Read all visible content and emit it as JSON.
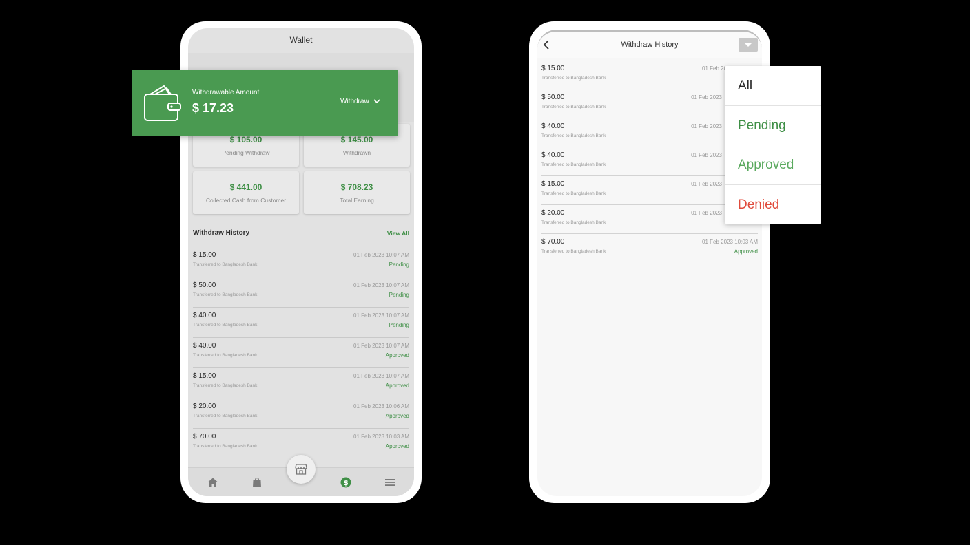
{
  "colors": {
    "brand_green": "#4a9a51",
    "text_green": "#3f8f46",
    "approved_green": "#5aa95e",
    "denied_red": "#e04b3c"
  },
  "wallet": {
    "title": "Wallet",
    "withdrawable_label": "Withdrawable Amount",
    "withdrawable_amount": "$ 17.23",
    "withdraw_button": "Withdraw",
    "stats": [
      {
        "value": "$ 105.00",
        "label": "Pending Withdraw"
      },
      {
        "value": "$ 145.00",
        "label": "Withdrawn"
      },
      {
        "value": "$ 441.00",
        "label": "Collected Cash from Customer"
      },
      {
        "value": "$ 708.23",
        "label": "Total Earning"
      }
    ],
    "history_title": "Withdraw History",
    "view_all": "View All",
    "history": [
      {
        "amount": "$ 15.00",
        "desc": "Transferred to Bangladesh Bank",
        "date": "01 Feb 2023  10:07 AM",
        "status": "Pending"
      },
      {
        "amount": "$ 50.00",
        "desc": "Transferred to Bangladesh Bank",
        "date": "01 Feb 2023  10:07 AM",
        "status": "Pending"
      },
      {
        "amount": "$ 40.00",
        "desc": "Transferred to Bangladesh Bank",
        "date": "01 Feb 2023  10:07 AM",
        "status": "Pending"
      },
      {
        "amount": "$ 40.00",
        "desc": "Transferred to Bangladesh Bank",
        "date": "01 Feb 2023  10:07 AM",
        "status": "Approved"
      },
      {
        "amount": "$ 15.00",
        "desc": "Transferred to Bangladesh Bank",
        "date": "01 Feb 2023  10:07 AM",
        "status": "Approved"
      },
      {
        "amount": "$ 20.00",
        "desc": "Transferred to Bangladesh Bank",
        "date": "01 Feb 2023  10:06 AM",
        "status": "Approved"
      },
      {
        "amount": "$ 70.00",
        "desc": "Transferred to Bangladesh Bank",
        "date": "01 Feb 2023  10:03 AM",
        "status": "Approved"
      }
    ],
    "nav_icons": [
      "home-icon",
      "shopping-bag-icon",
      "store-icon",
      "dollar-icon",
      "menu-icon"
    ]
  },
  "history_page": {
    "title": "Withdraw History",
    "history": [
      {
        "amount": "$ 15.00",
        "desc": "Transferred to Bangladesh Bank",
        "date": "01 Feb 2023  10:07 AM",
        "status": ""
      },
      {
        "amount": "$ 50.00",
        "desc": "Transferred to Bangladesh Bank",
        "date": "01 Feb 2023",
        "status": ""
      },
      {
        "amount": "$ 40.00",
        "desc": "Transferred to Bangladesh Bank",
        "date": "01 Feb 2023",
        "status": ""
      },
      {
        "amount": "$ 40.00",
        "desc": "Transferred to Bangladesh Bank",
        "date": "01 Feb 2023",
        "status": ""
      },
      {
        "amount": "$ 15.00",
        "desc": "Transferred to Bangladesh Bank",
        "date": "01 Feb 2023",
        "status": ""
      },
      {
        "amount": "$ 20.00",
        "desc": "Transferred to Bangladesh Bank",
        "date": "01 Feb 2023",
        "status": ""
      },
      {
        "amount": "$ 70.00",
        "desc": "Transferred to Bangladesh Bank",
        "date": "01 Feb 2023  10:03 AM",
        "status": "Approved"
      }
    ],
    "filter_options": [
      {
        "label": "All",
        "color": "#2b2b2b"
      },
      {
        "label": "Pending",
        "color": "#3f8f46"
      },
      {
        "label": "Approved",
        "color": "#5aa95e"
      },
      {
        "label": "Denied",
        "color": "#e04b3c"
      }
    ]
  }
}
